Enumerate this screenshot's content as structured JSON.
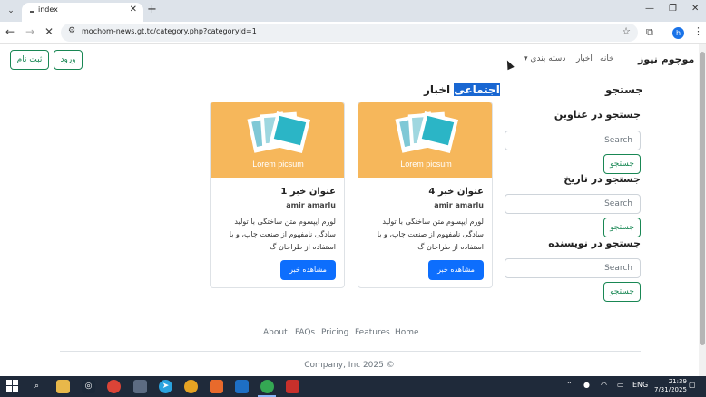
{
  "browser": {
    "tab_title": "index",
    "url": "mochom-news.gt.tc/category.php?categoryId=1",
    "profile_initial": "h",
    "icons": {
      "tab_menu": "chevron-down-icon",
      "close_tab": "close-icon",
      "new_tab": "plus-icon",
      "back": "arrow-left-icon",
      "forward": "arrow-right-icon",
      "stop": "close-icon",
      "site_info": "tune-icon",
      "bookmark": "star-icon",
      "extensions": "puzzle-icon",
      "menu": "kebab-icon"
    }
  },
  "navbar": {
    "brand": "موچوم نیوز",
    "home": "خانه",
    "news": "اخبار",
    "category": "دسته بندی",
    "login": "ورود",
    "register": "ثبت نام"
  },
  "main": {
    "heading_prefix": "اخبار",
    "heading_highlight": "اجتماعی",
    "cards": [
      {
        "image_caption": "Lorem picsum",
        "title": "عنوان خبر 4",
        "author": "amir amarlu",
        "description": "لورم ایپسوم متن ساختگی با تولید سادگی نامفهوم از صنعت چاپ، و با استفاده از طراحان گ",
        "button": "مشاهده خبر"
      },
      {
        "image_caption": "Lorem picsum",
        "title": "عنوان خبر 1",
        "author": "amir amarlu",
        "description": "لورم ایپسوم متن ساختگی با تولید سادگی نامفهوم از صنعت چاپ، و با استفاده از طراحان گ",
        "button": "مشاهده خبر"
      }
    ]
  },
  "sidebar": {
    "title": "جستجو",
    "sections": [
      {
        "title": "جستجو در عناوین",
        "placeholder": "Search",
        "button": "جستجو"
      },
      {
        "title": "جستجو در تاریخ",
        "placeholder": "Search",
        "button": "جستجو"
      },
      {
        "title": "جستجو در نویسنده",
        "placeholder": "Search",
        "button": "جستجو"
      }
    ]
  },
  "footer": {
    "links": [
      "About",
      "FAQs",
      "Pricing",
      "Features",
      "Home"
    ],
    "copyright": "Company, Inc 2025 ©"
  },
  "taskbar": {
    "language": "ENG",
    "time": "21:39",
    "date": "7/31/2025"
  },
  "colors": {
    "accent": "#0d6efd",
    "success": "#198754",
    "placeholder_image": "#f6b75b",
    "highlight": "#1967d2"
  }
}
